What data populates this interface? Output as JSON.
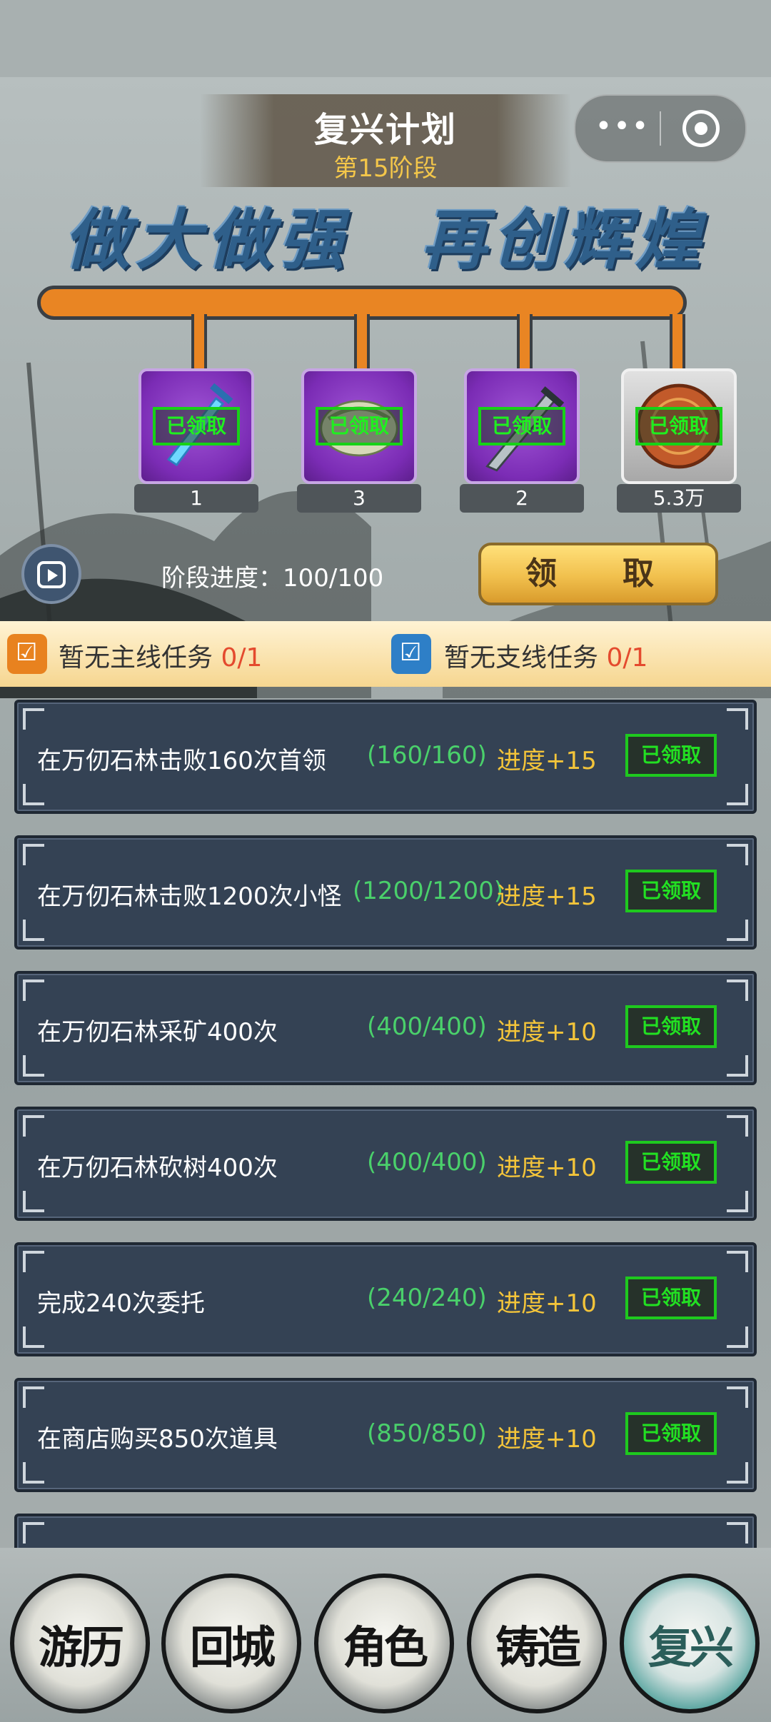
{
  "header": {
    "title": "复兴计划",
    "stage": "第15阶段",
    "slogan": "做大做强　再创辉煌",
    "capsule": {
      "more": "•••"
    }
  },
  "rewards": [
    {
      "count": "1",
      "status": "已领取",
      "icon": "sword-icon"
    },
    {
      "count": "3",
      "status": "已领取",
      "icon": "scroll-icon"
    },
    {
      "count": "2",
      "status": "已领取",
      "icon": "dagger-icon"
    },
    {
      "count": "5.3万",
      "status": "已领取",
      "icon": "coin-icon"
    }
  ],
  "progress": {
    "label": "阶段进度：100/100",
    "current": 100,
    "max": 100
  },
  "claim_button": "领　取",
  "task_tabs": {
    "main": {
      "label": "暂无主线任务 ",
      "count": "0/1"
    },
    "side": {
      "label": "暂无支线任务 ",
      "count": "0/1"
    }
  },
  "tasks": [
    {
      "name": "在万仞石林击败160次首领",
      "count": "(160/160)",
      "reward": "进度+15",
      "status": "已领取"
    },
    {
      "name": "在万仞石林击败1200次小怪",
      "count": "(1200/1200)",
      "reward": "进度+15",
      "status": "已领取"
    },
    {
      "name": "在万仞石林采矿400次",
      "count": "(400/400)",
      "reward": "进度+10",
      "status": "已领取"
    },
    {
      "name": "在万仞石林砍树400次",
      "count": "(400/400)",
      "reward": "进度+10",
      "status": "已领取"
    },
    {
      "name": "完成240次委托",
      "count": "(240/240)",
      "reward": "进度+10",
      "status": "已领取"
    },
    {
      "name": "在商店购买850次道具",
      "count": "(850/850)",
      "reward": "进度+10",
      "status": "已领取"
    }
  ],
  "nav": [
    {
      "label": "游历"
    },
    {
      "label": "回城"
    },
    {
      "label": "角色"
    },
    {
      "label": "铸造"
    },
    {
      "label": "复兴",
      "active": true
    }
  ],
  "colors": {
    "accent_orange": "#e98523",
    "claimed_green": "#1ec91e",
    "progress_yellow": "#f3c43a",
    "count_green": "#4ad06b"
  }
}
